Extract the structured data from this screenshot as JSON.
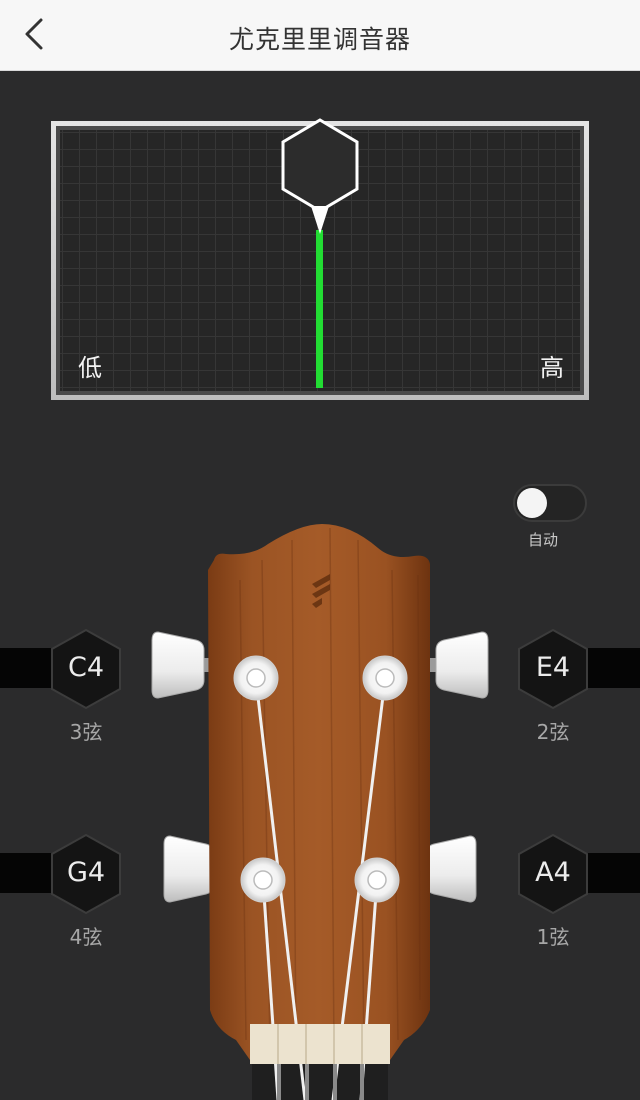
{
  "header": {
    "title": "尤克里里调音器",
    "back_icon": "chevron-left-icon"
  },
  "meter": {
    "low_label": "低",
    "high_label": "高",
    "needle_color": "#22dd33",
    "pitch_offset": 0
  },
  "auto_toggle": {
    "label": "自动",
    "on": false
  },
  "strings": [
    {
      "note": "C4",
      "label": "3弦"
    },
    {
      "note": "E4",
      "label": "2弦"
    },
    {
      "note": "G4",
      "label": "4弦"
    },
    {
      "note": "A4",
      "label": "1弦"
    }
  ]
}
